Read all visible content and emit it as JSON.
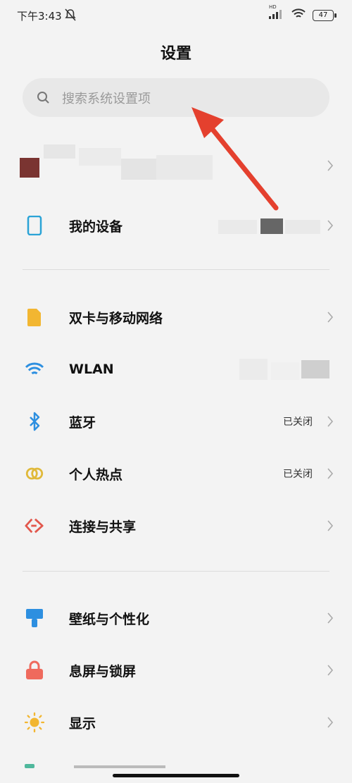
{
  "status_bar": {
    "time": "下午3:43",
    "hd_label": "HD",
    "battery": "47"
  },
  "header": {
    "title": "设置"
  },
  "search": {
    "placeholder": "搜索系统设置项"
  },
  "sections": [
    {
      "items": [
        {
          "label": "我的设备",
          "value": "",
          "icon": "phone-outline-icon",
          "color": "#2aa3d6"
        }
      ]
    },
    {
      "items": [
        {
          "label": "双卡与移动网络",
          "value": "",
          "icon": "sim-card-icon",
          "color": "#f2b631"
        },
        {
          "label": "WLAN",
          "value": "",
          "icon": "wifi-icon",
          "color": "#2d8fe0"
        },
        {
          "label": "蓝牙",
          "value": "已关闭",
          "icon": "bluetooth-icon",
          "color": "#2d8fe0"
        },
        {
          "label": "个人热点",
          "value": "已关闭",
          "icon": "hotspot-icon",
          "color": "#e0b93a"
        },
        {
          "label": "连接与共享",
          "value": "",
          "icon": "connection-share-icon",
          "color": "#e2574c"
        }
      ]
    },
    {
      "items": [
        {
          "label": "壁纸与个性化",
          "value": "",
          "icon": "wallpaper-brush-icon",
          "color": "#2d8fe0"
        },
        {
          "label": "息屏与锁屏",
          "value": "",
          "icon": "lock-icon",
          "color": "#ef6a5d"
        },
        {
          "label": "显示",
          "value": "",
          "icon": "sun-icon",
          "color": "#f2b631"
        }
      ]
    }
  ],
  "accent_color": "#e4402e"
}
